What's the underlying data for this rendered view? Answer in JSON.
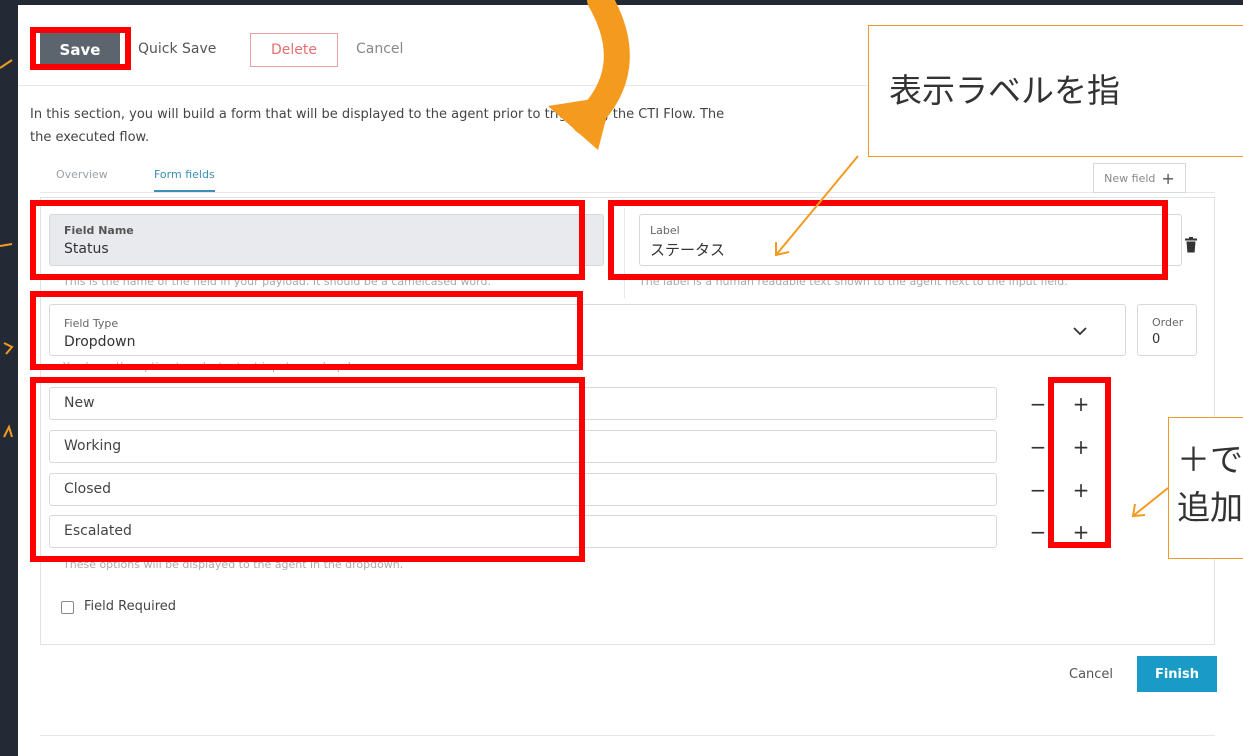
{
  "toolbar": {
    "save": "Save",
    "quick_save": "Quick Save",
    "delete": "Delete",
    "cancel": "Cancel"
  },
  "description": "In this section, you will build a form that will be displayed to the agent prior to triggering the CTI Flow. The",
  "description_line2": "the executed flow.",
  "tabs": [
    {
      "label": "Overview"
    },
    {
      "label": "Form fields"
    }
  ],
  "new_field": {
    "label": "New field",
    "icon": "+"
  },
  "field_name": {
    "label": "Field Name",
    "value": "Status",
    "hint": "This is the name of the field in your payload. It should be a camelcased word."
  },
  "label_field": {
    "label": "Label",
    "value": "ステータス",
    "hint": "The label is a human readable text shown to the agent next to the input field."
  },
  "field_type": {
    "label": "Field Type",
    "value": "Dropdown",
    "hint": "You have the option to select a text input or a dropdown."
  },
  "order": {
    "label": "Order",
    "value": "0"
  },
  "options": [
    "New",
    "Working",
    "Closed",
    "Escalated"
  ],
  "options_hint": "These options will be displayed to the agent in the dropdown.",
  "required_label": "Field Required",
  "footer": {
    "cancel": "Cancel",
    "finish": "Finish"
  },
  "callouts": {
    "top": "表示ラベルを指",
    "bottom_line1": "＋で",
    "bottom_line2": "追加"
  },
  "colors": {
    "accent": "#1a9bc7",
    "annotation_red": "#ff0000",
    "annotation_orange": "#f39a1f"
  }
}
